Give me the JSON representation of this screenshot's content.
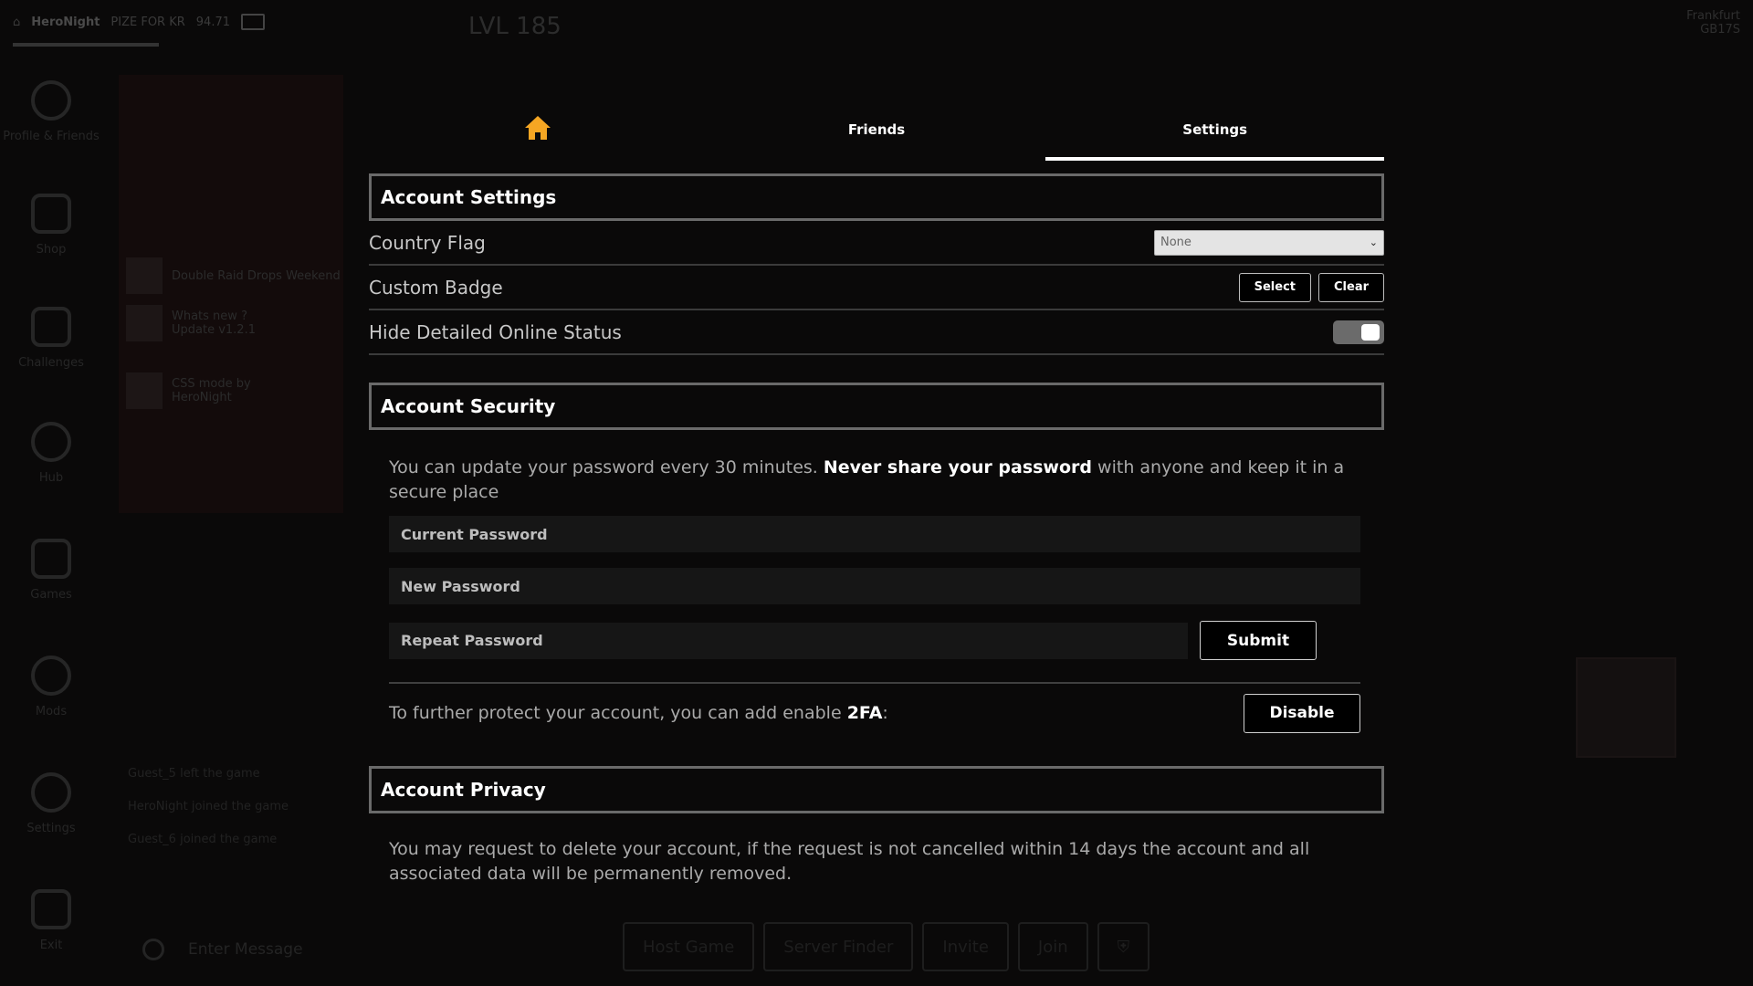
{
  "background": {
    "player_name": "HeroNight",
    "player_tag": "PIZE FOR KR",
    "currency": "94.71",
    "level": "LVL 185",
    "region": "Frankfurt",
    "region_sub": "GB17S",
    "sidebar": [
      {
        "label": "Profile & Friends",
        "icon": "person-icon"
      },
      {
        "label": "Shop",
        "icon": "shop-icon"
      },
      {
        "label": "Challenges",
        "icon": "flag-icon"
      },
      {
        "label": "Hub",
        "icon": "globe-icon"
      },
      {
        "label": "Games",
        "icon": "gamepad-icon"
      },
      {
        "label": "Mods",
        "icon": "palette-icon"
      },
      {
        "label": "Settings",
        "icon": "gear-icon"
      },
      {
        "label": "Exit",
        "icon": "exit-icon"
      }
    ],
    "news": [
      {
        "title": "Double Raid Drops Weekend",
        "sub": ""
      },
      {
        "title": "Whats new ?",
        "sub": "Update v1.2.1"
      },
      {
        "title": "CSS mode by",
        "sub": "HeroNight"
      }
    ],
    "chat": [
      "Guest_5 left the game",
      "HeroNight joined the game",
      "Guest_6 joined the game"
    ],
    "chat_placeholder": "Enter Message",
    "bottom_buttons": [
      "Host Game",
      "Server Finder",
      "Invite",
      "Join"
    ]
  },
  "tabs": [
    {
      "label": "",
      "icon": "home-icon",
      "active": false
    },
    {
      "label": "Friends",
      "active": false
    },
    {
      "label": "Settings",
      "active": true
    }
  ],
  "account_settings": {
    "title": "Account Settings",
    "country_flag": {
      "label": "Country Flag",
      "value": "None"
    },
    "custom_badge": {
      "label": "Custom Badge",
      "select_label": "Select",
      "clear_label": "Clear"
    },
    "hide_status": {
      "label": "Hide Detailed Online Status",
      "enabled": true
    }
  },
  "account_security": {
    "title": "Account Security",
    "desc_pre": "You can update your password every 30 minutes. ",
    "desc_strong": "Never share your password",
    "desc_post": " with anyone and keep it in a secure place",
    "current_password_placeholder": "Current Password",
    "new_password_placeholder": "New Password",
    "repeat_password_placeholder": "Repeat Password",
    "submit_label": "Submit",
    "twofa_pre": "To further protect your account, you can add enable ",
    "twofa_strong": "2FA",
    "twofa_post": ":",
    "disable_label": "Disable"
  },
  "account_privacy": {
    "title": "Account Privacy",
    "desc": "You may request to delete your account, if the request is not cancelled within 14 days the account and all associated data will be permanently removed."
  },
  "colors": {
    "accent_home": "#f5a623",
    "section_border": "#6a6a6a",
    "background": "#0a0909"
  }
}
